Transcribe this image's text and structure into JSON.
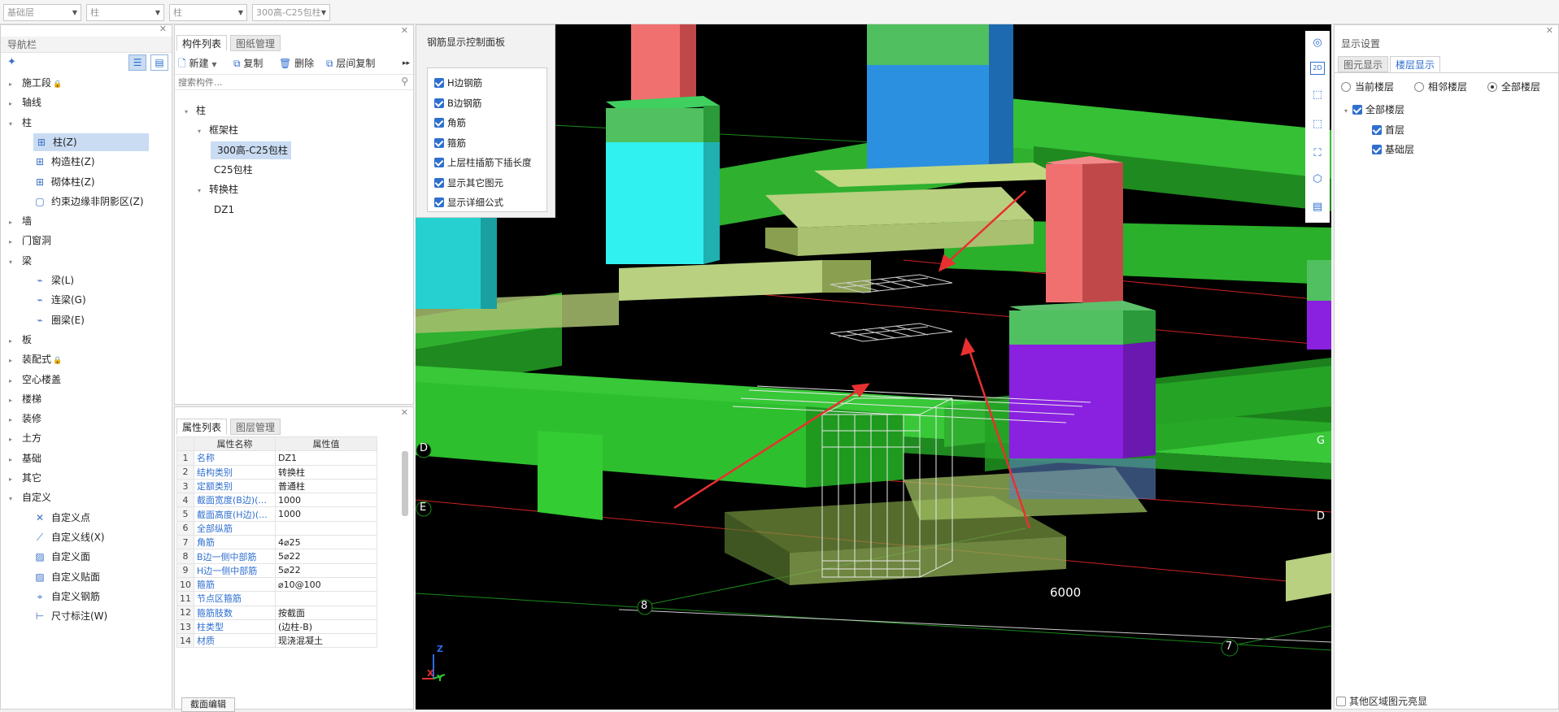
{
  "topbar": {
    "dropdowns": [
      "基础层",
      "柱",
      "柱",
      "300高-C25包柱"
    ]
  },
  "nav": {
    "title": "导航栏",
    "items": [
      {
        "label": "施工段",
        "lock": "🔒",
        "level": 0,
        "caret": "▸"
      },
      {
        "label": "轴线",
        "level": 0,
        "caret": "▸"
      },
      {
        "label": "柱",
        "level": 0,
        "caret": "▾"
      },
      {
        "label": "柱(Z)",
        "level": 1,
        "icon": "column-icon",
        "selected": true
      },
      {
        "label": "构造柱(Z)",
        "level": 1,
        "icon": "column-icon"
      },
      {
        "label": "砌体柱(Z)",
        "level": 1,
        "icon": "column-icon"
      },
      {
        "label": "约束边缘非阴影区(Z)",
        "level": 1,
        "icon": "square-icon"
      },
      {
        "label": "墙",
        "level": 0,
        "caret": "▸"
      },
      {
        "label": "门窗洞",
        "level": 0,
        "caret": "▸"
      },
      {
        "label": "梁",
        "level": 0,
        "caret": "▾"
      },
      {
        "label": "梁(L)",
        "level": 1,
        "icon": "beam-icon"
      },
      {
        "label": "连梁(G)",
        "level": 1,
        "icon": "beam-icon"
      },
      {
        "label": "圈梁(E)",
        "level": 1,
        "icon": "beam-icon"
      },
      {
        "label": "板",
        "level": 0,
        "caret": "▸"
      },
      {
        "label": "装配式",
        "lock": "🔒",
        "level": 0,
        "caret": "▸"
      },
      {
        "label": "空心楼盖",
        "level": 0,
        "caret": "▸"
      },
      {
        "label": "楼梯",
        "level": 0,
        "caret": "▸"
      },
      {
        "label": "装修",
        "level": 0,
        "caret": "▸"
      },
      {
        "label": "土方",
        "level": 0,
        "caret": "▸"
      },
      {
        "label": "基础",
        "level": 0,
        "caret": "▸"
      },
      {
        "label": "其它",
        "level": 0,
        "caret": "▸"
      },
      {
        "label": "自定义",
        "level": 0,
        "caret": "▾"
      },
      {
        "label": "自定义点",
        "level": 1,
        "icon": "point-icon"
      },
      {
        "label": "自定义线(X)",
        "level": 1,
        "icon": "line-icon"
      },
      {
        "label": "自定义面",
        "level": 1,
        "icon": "face-icon"
      },
      {
        "label": "自定义贴面",
        "level": 1,
        "icon": "face-icon"
      },
      {
        "label": "自定义钢筋",
        "level": 1,
        "icon": "rebar-icon"
      },
      {
        "label": "尺寸标注(W)",
        "level": 1,
        "icon": "dimension-icon"
      }
    ]
  },
  "components": {
    "tabs": [
      "构件列表",
      "图纸管理"
    ],
    "toolbar": {
      "new": "新建",
      "copy": "复制",
      "delete": "删除",
      "floor_copy": "层间复制"
    },
    "search_placeholder": "搜索构件...",
    "tree": [
      {
        "label": "柱",
        "level": 0,
        "caret": "▾"
      },
      {
        "label": "框架柱",
        "level": 1,
        "caret": "▾"
      },
      {
        "label": "300高-C25包柱",
        "level": 2,
        "selected": true
      },
      {
        "label": "C25包柱",
        "level": 2
      },
      {
        "label": "转换柱",
        "level": 1,
        "caret": "▾"
      },
      {
        "label": "DZ1",
        "level": 2
      }
    ]
  },
  "properties": {
    "tabs": [
      "属性列表",
      "图层管理"
    ],
    "header": {
      "name": "属性名称",
      "value": "属性值"
    },
    "rows": [
      {
        "n": "1",
        "k": "名称",
        "v": "DZ1"
      },
      {
        "n": "2",
        "k": "结构类别",
        "v": "转换柱"
      },
      {
        "n": "3",
        "k": "定额类别",
        "v": "普通柱"
      },
      {
        "n": "4",
        "k": "截面宽度(B边)(...",
        "v": "1000"
      },
      {
        "n": "5",
        "k": "截面高度(H边)(...",
        "v": "1000"
      },
      {
        "n": "6",
        "k": "全部纵筋",
        "v": ""
      },
      {
        "n": "7",
        "k": "角筋",
        "v": "4⌀25"
      },
      {
        "n": "8",
        "k": "B边一侧中部筋",
        "v": "5⌀22"
      },
      {
        "n": "9",
        "k": "H边一侧中部筋",
        "v": "5⌀22"
      },
      {
        "n": "10",
        "k": "箍筋",
        "v": "⌀10@100"
      },
      {
        "n": "11",
        "k": "节点区箍筋",
        "v": ""
      },
      {
        "n": "12",
        "k": "箍筋肢数",
        "v": "按截面"
      },
      {
        "n": "13",
        "k": "柱类型",
        "v": "(边柱-B)"
      },
      {
        "n": "14",
        "k": "材质",
        "v": "现浇混凝土"
      }
    ],
    "footer_button": "截面编辑"
  },
  "rebar_panel": {
    "title": "钢筋显示控制面板",
    "items": [
      {
        "label": "H边钢筋",
        "checked": true
      },
      {
        "label": "B边钢筋",
        "checked": true
      },
      {
        "label": "角筋",
        "checked": true
      },
      {
        "label": "箍筋",
        "checked": true
      },
      {
        "label": "上层柱插筋下插长度",
        "checked": true
      },
      {
        "label": "显示其它图元",
        "checked": true
      },
      {
        "label": "显示详细公式",
        "checked": true
      }
    ]
  },
  "viewport": {
    "axis_labels": {
      "d_left": "D",
      "e_left": "E",
      "d_right": "D",
      "g_right": "G",
      "num8": "8",
      "num7": "7",
      "dim": "6000"
    },
    "axes_gizmo": {
      "x": "X",
      "y": "Y",
      "z": "Z"
    },
    "tool_2d": "2D"
  },
  "display_settings": {
    "title": "显示设置",
    "tabs": [
      "图元显示",
      "楼层显示"
    ],
    "radios": [
      {
        "label": "当前楼层",
        "on": false
      },
      {
        "label": "相邻楼层",
        "on": false
      },
      {
        "label": "全部楼层",
        "on": true
      }
    ],
    "tree": [
      {
        "label": "全部楼层",
        "level": 0,
        "checked": true
      },
      {
        "label": "首层",
        "level": 1,
        "checked": true
      },
      {
        "label": "基础层",
        "level": 1,
        "checked": true
      }
    ],
    "footer_checkbox": "其他区域图元亮显"
  },
  "colors": {
    "accent": "#2f6fcf",
    "selected": "#c9dcf2"
  }
}
